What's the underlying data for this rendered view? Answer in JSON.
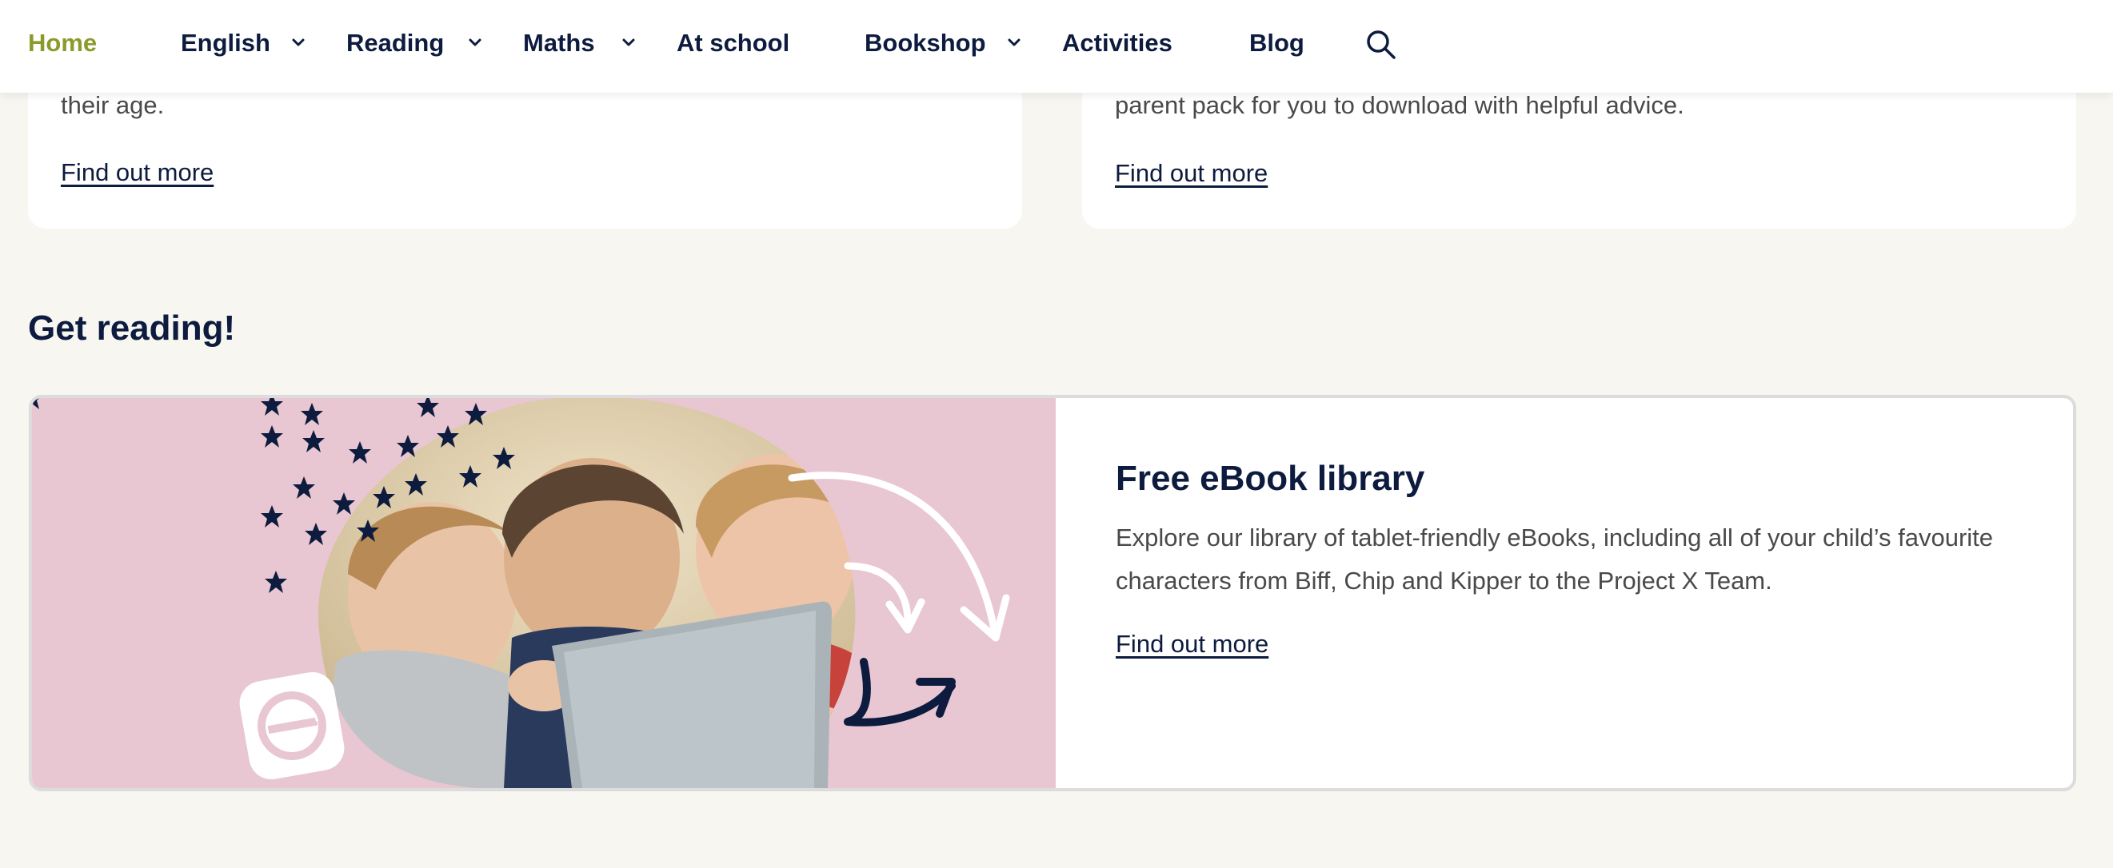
{
  "nav": {
    "items": [
      {
        "label": "Home",
        "active": true
      },
      {
        "label": "English",
        "has_dropdown": true
      },
      {
        "label": "Reading",
        "has_dropdown": true
      },
      {
        "label": "Maths",
        "has_dropdown": true
      },
      {
        "label": "At school"
      },
      {
        "label": "Bookshop",
        "has_dropdown": true
      },
      {
        "label": "Activities"
      },
      {
        "label": "Blog"
      }
    ],
    "search_icon": "search-icon",
    "colors": {
      "active": "#8c9a2c",
      "text": "#0d1b3e"
    }
  },
  "cards": [
    {
      "text_tail": "their age.",
      "link": "Find out more"
    },
    {
      "text_tail": "parent pack for you to download with helpful advice.",
      "link": "Find out more"
    }
  ],
  "section": {
    "title": "Get reading!"
  },
  "feature": {
    "title": "Free eBook library",
    "description": "Explore our library of tablet-friendly eBooks, including all of your child’s favourite characters from Biff, Chip and Kipper to the Project X Team.",
    "link": "Find out more",
    "image_alt": "three children looking at a tablet",
    "badge_icon": "ebook-e-icon",
    "colors": {
      "image_bg": "#e8c7d2",
      "page_bg": "#f7f6f1",
      "border": "#dcdcdc"
    }
  }
}
